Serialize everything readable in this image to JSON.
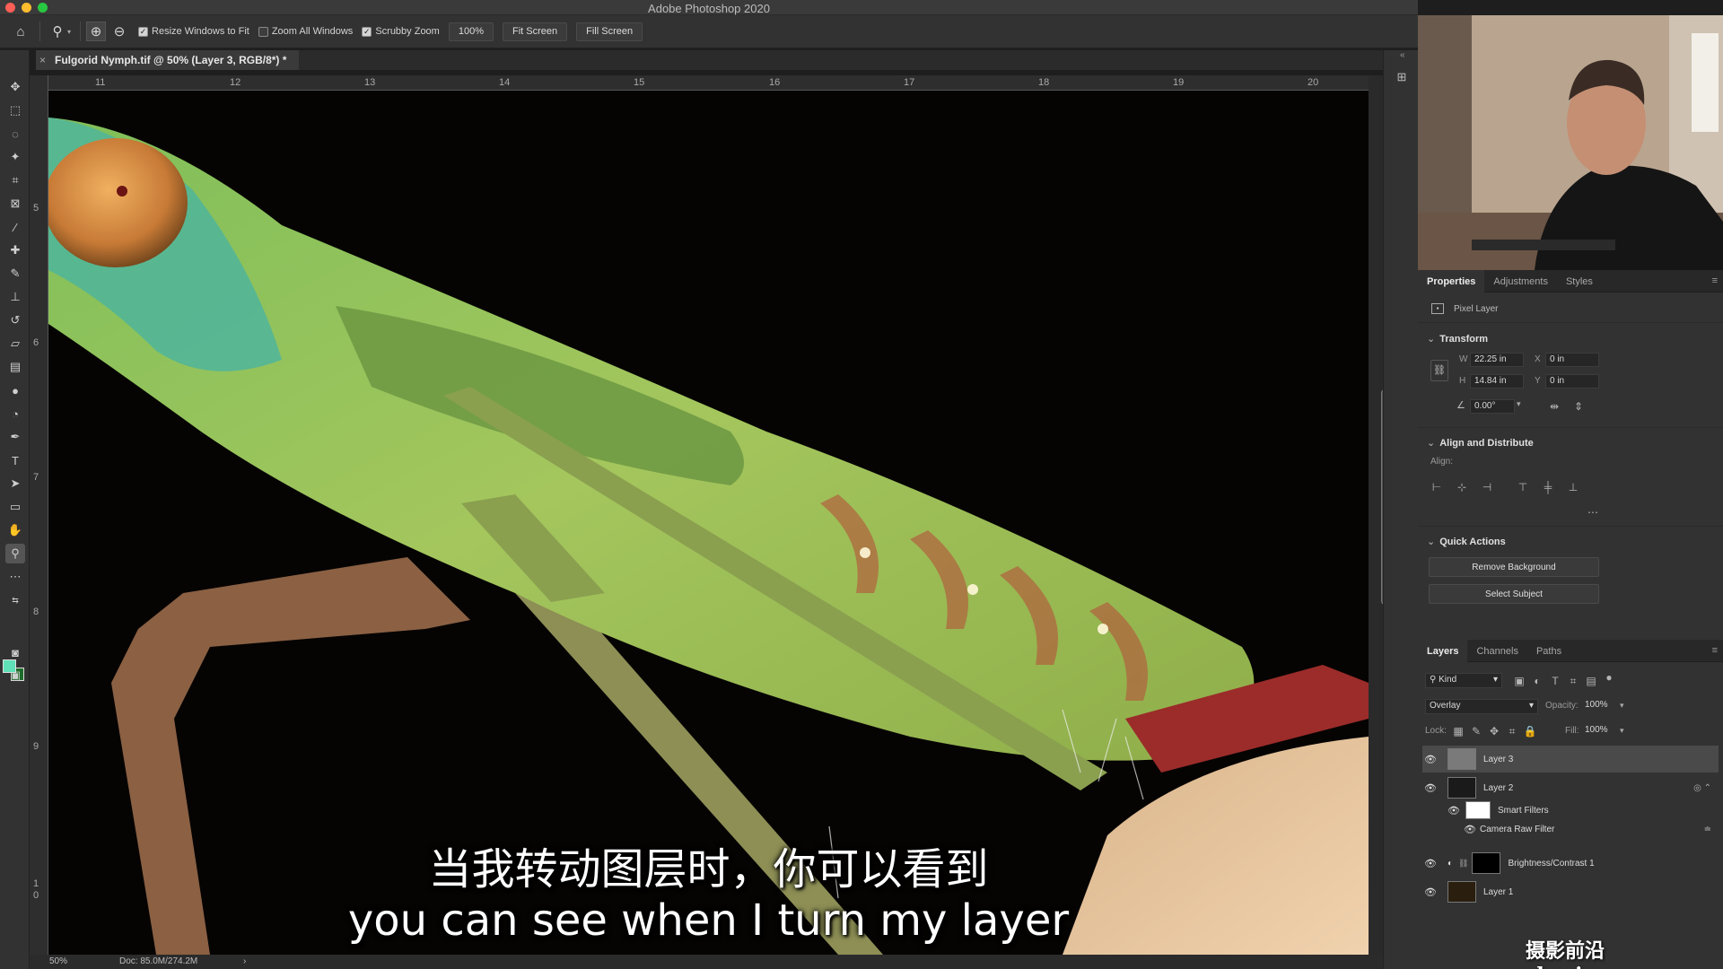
{
  "window": {
    "title": "Adobe Photoshop 2020"
  },
  "options_bar": {
    "resize_windows": "Resize Windows to Fit",
    "zoom_all": "Zoom All Windows",
    "scrubby_zoom": "Scrubby Zoom",
    "zoom_value": "100%",
    "fit_screen": "Fit Screen",
    "fill_screen": "Fill Screen"
  },
  "document": {
    "tab_title": "Fulgorid Nymph.tif @ 50% (Layer 3, RGB/8*) *"
  },
  "ruler": {
    "h_ticks": [
      "11",
      "12",
      "13",
      "14",
      "15",
      "16",
      "17",
      "18",
      "19",
      "20"
    ],
    "v_ticks": [
      "5",
      "6",
      "7",
      "8",
      "9",
      "1",
      "0"
    ]
  },
  "subtitles": {
    "zh": "当我转动图层时，你可以看到",
    "en": "you can see when I turn my layer"
  },
  "status_bar": {
    "zoom": "50%",
    "doc": "Doc: 85.0M/274.2M"
  },
  "properties": {
    "tabs": [
      "Properties",
      "Adjustments",
      "Styles"
    ],
    "pixel_layer": "Pixel Layer",
    "transform": {
      "title": "Transform",
      "w_label": "W",
      "w": "22.25 in",
      "h_label": "H",
      "h": "14.84 in",
      "x_label": "X",
      "x": "0 in",
      "y_label": "Y",
      "y": "0 in",
      "angle": "0.00°"
    },
    "align": {
      "title": "Align and Distribute",
      "align_label": "Align:"
    },
    "quick_actions": {
      "title": "Quick Actions",
      "remove_bg": "Remove Background",
      "select_subject": "Select Subject"
    }
  },
  "layers_panel": {
    "tabs": [
      "Layers",
      "Channels",
      "Paths"
    ],
    "kind": "Kind",
    "blend_mode": "Overlay",
    "opacity_label": "Opacity:",
    "opacity": "100%",
    "lock_label": "Lock:",
    "fill_label": "Fill:",
    "fill": "100%",
    "layers": [
      {
        "name": "Layer 3"
      },
      {
        "name": "Layer 2"
      },
      {
        "name": "Smart Filters"
      },
      {
        "name": "Camera Raw Filter"
      },
      {
        "name": "Brightness/Contrast 1"
      },
      {
        "name": "Layer 1"
      }
    ]
  },
  "watermark": "摄影前沿 sheyingzyz.com",
  "colors": {
    "foreground": "#5fe0b7",
    "background": "#1f6b2b",
    "selected_layer": "#4a4a4a"
  }
}
